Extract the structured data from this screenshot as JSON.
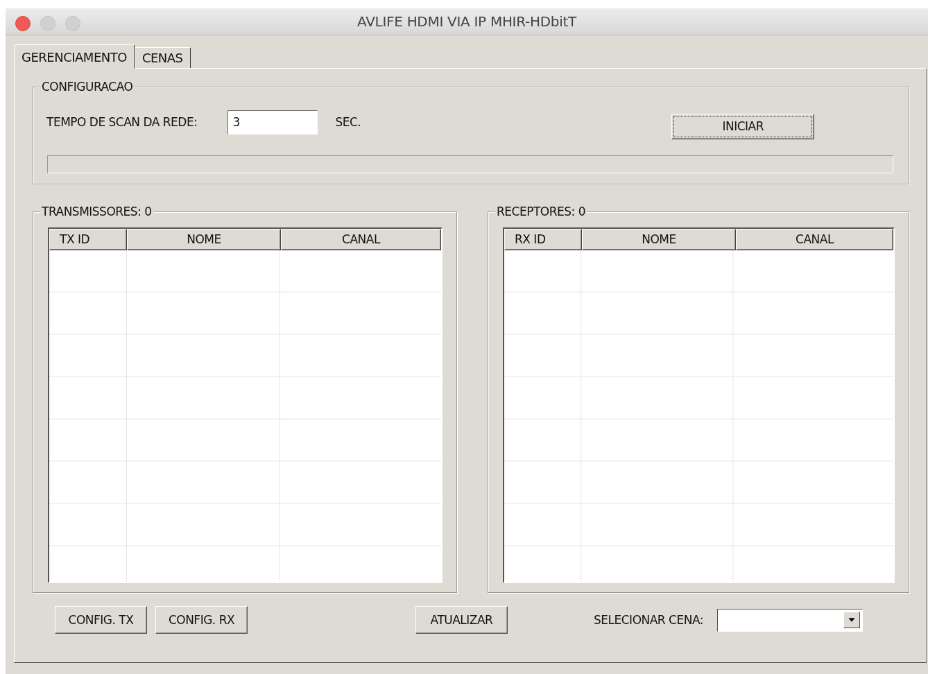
{
  "window": {
    "title": "AVLIFE HDMI VIA IP MHIR-HDbitT"
  },
  "tabs": [
    {
      "label": "GERENCIAMENTO",
      "selected": true
    },
    {
      "label": "CENAS",
      "selected": false
    }
  ],
  "configuracao": {
    "title": "CONFIGURACAO",
    "scan_label": "TEMPO DE SCAN DA REDE:",
    "scan_value": "3",
    "unit": "SEC.",
    "start_button": "INICIAR",
    "progress": {
      "level": 0
    }
  },
  "tables": [
    {
      "title": "TRANSMISSORES: 0",
      "columns": [
        "TX ID",
        "NOME",
        "CANAL"
      ]
    },
    {
      "title": "RECEPTORES: 0",
      "columns": [
        "RX ID",
        "NOME",
        "CANAL"
      ]
    }
  ],
  "bottom": {
    "buttons": [
      "CONFIG. TX",
      "CONFIG. RX",
      "ATUALIZAR"
    ],
    "scene_label": "SELECIONAR CENA:"
  }
}
